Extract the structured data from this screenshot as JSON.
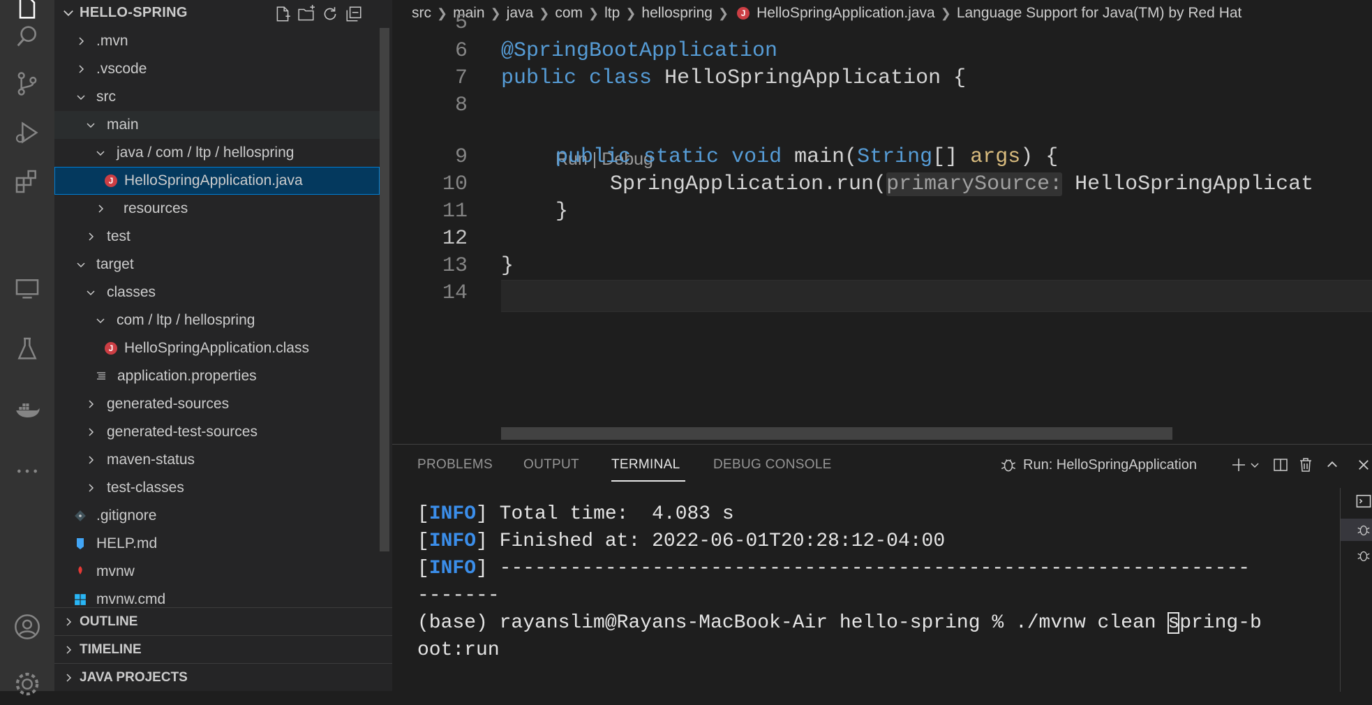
{
  "activity_bar": {
    "icons": [
      "files-icon",
      "search-icon",
      "source-control-icon",
      "run-debug-icon",
      "extensions-icon",
      "remote-explorer-icon",
      "testing-icon",
      "docker-icon",
      "more-icon",
      "account-icon",
      "settings-gear-icon"
    ]
  },
  "sidebar": {
    "title": "HELLO-SPRING",
    "tree": [
      {
        "label": ".mvn",
        "state": "collapsed"
      },
      {
        "label": ".vscode",
        "state": "collapsed"
      },
      {
        "label": "src",
        "state": "expanded"
      },
      {
        "label": "main",
        "state": "expanded"
      },
      {
        "label": "java / com / ltp / hellospring",
        "state": "expanded"
      },
      {
        "label": "HelloSpringApplication.java",
        "state": "file-java",
        "selected": true
      },
      {
        "label": "resources",
        "state": "collapsed"
      },
      {
        "label": "test",
        "state": "collapsed"
      },
      {
        "label": "target",
        "state": "expanded"
      },
      {
        "label": "classes",
        "state": "expanded"
      },
      {
        "label": "com / ltp / hellospring",
        "state": "expanded"
      },
      {
        "label": "HelloSpringApplication.class",
        "state": "file-java"
      },
      {
        "label": "application.properties",
        "state": "file-props"
      },
      {
        "label": "generated-sources",
        "state": "collapsed"
      },
      {
        "label": "generated-test-sources",
        "state": "collapsed"
      },
      {
        "label": "maven-status",
        "state": "collapsed"
      },
      {
        "label": "test-classes",
        "state": "collapsed"
      },
      {
        "label": ".gitignore",
        "state": "file-git"
      },
      {
        "label": "HELP.md",
        "state": "file-md"
      },
      {
        "label": "mvnw",
        "state": "file-mvnw"
      },
      {
        "label": "mvnw.cmd",
        "state": "file-cmd"
      }
    ],
    "sections": [
      "OUTLINE",
      "TIMELINE",
      "JAVA PROJECTS"
    ]
  },
  "breadcrumbs": [
    "src",
    "main",
    "java",
    "com",
    "ltp",
    "hellospring",
    "HelloSpringApplication.java",
    "Language Support for Java(TM) by Red Hat"
  ],
  "editor": {
    "line_numbers": [
      "5",
      "6",
      "7",
      "8",
      "9",
      "10",
      "11",
      "12",
      "13",
      "14"
    ],
    "codelens": "Run | Debug",
    "code": {
      "l6_annotation": "@SpringBootApplication",
      "l7_kw1": "public",
      "l7_kw2": "class",
      "l7_name": "HelloSpringApplication",
      "l7_brace": " {",
      "l9_kw1": "public",
      "l9_kw2": "static",
      "l9_kw3": "void",
      "l9_fn": "main",
      "l9_p1": "(",
      "l9_type": "String",
      "l9_arr": "[] ",
      "l9_arg": "args",
      "l9_p2": ") {",
      "l10_call": "SpringApplication.run(",
      "l10_hint": "primarySource:",
      "l10_rest": " HelloSpringApplicat",
      "l11": "}",
      "l13": "}"
    }
  },
  "panel": {
    "tabs": [
      "PROBLEMS",
      "OUTPUT",
      "TERMINAL",
      "DEBUG CONSOLE"
    ],
    "active_tab": "TERMINAL",
    "run_label": "Run: HelloSpringApplication",
    "terminal": {
      "info_tag": "INFO",
      "line1": " Total time:  4.083 s",
      "line2": " Finished at: 2022-06-01T20:28:12-04:00",
      "line3": " ----------------------------------------------------------------",
      "line4": "-------",
      "line5_pre": "(base) rayanslim@Rayans-MacBook-Air hello-spring % ./mvnw clean ",
      "line5_cursor": "s",
      "line5_post": "pring-b",
      "line6": "oot:run"
    }
  },
  "colors": {
    "activity_bar": "#333333",
    "sidebar": "#252526",
    "editor": "#1e1e1e",
    "selection": "#04395e",
    "info": "#3b8eea",
    "java_icon": "#cc3e44"
  }
}
